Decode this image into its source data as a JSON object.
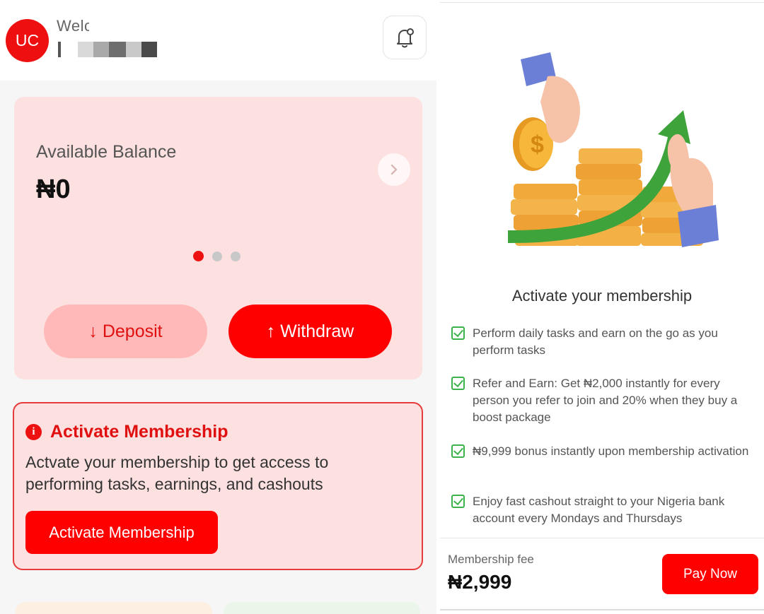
{
  "header": {
    "avatar_initials": "UC",
    "welcome_text": "Welc",
    "notification_icon": "bell-icon"
  },
  "balance": {
    "label": "Available Balance",
    "value": "₦0",
    "next_icon": "chevron-right-icon",
    "carousel_pages": 3,
    "carousel_active_index": 0,
    "deposit_label": "↓ Deposit",
    "withdraw_label": "↑ Withdraw"
  },
  "activate_card": {
    "title": "Activate Membership",
    "description": "Actvate your membership to get access to performing tasks, earnings, and cashouts",
    "button_label": "Activate Membership",
    "icon": "info-icon"
  },
  "modal": {
    "title": "Activate your membership",
    "features": [
      "Perform daily tasks and earn on the go as you perform tasks",
      "Refer and Earn: Get ₦2,000 instantly for every person you refer to join and 20% when they buy a boost package",
      "₦9,999 bonus instantly upon membership activation",
      "Enjoy fast cashout straight to your Nigeria bank account every Mondays and Thursdays"
    ],
    "fee_label": "Membership fee",
    "fee_value": "₦2,999",
    "pay_label": "Pay Now"
  },
  "colors": {
    "accent": "#ff0000",
    "card_pink": "#fde0e0",
    "check_green": "#3bb34a"
  }
}
